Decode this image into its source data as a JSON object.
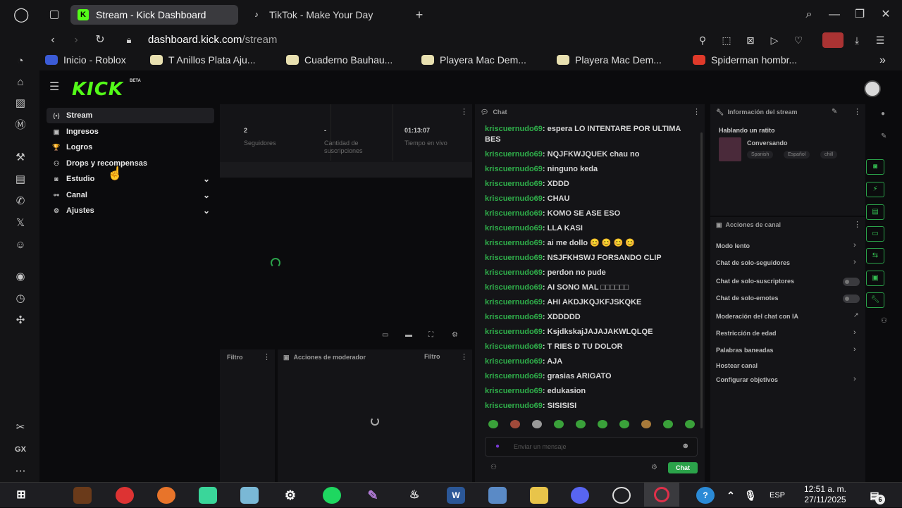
{
  "browser": {
    "tabs": [
      {
        "title": "Stream - Kick Dashboard",
        "active": true
      },
      {
        "title": "TikTok - Make Your Day",
        "active": false
      }
    ],
    "new_tab": "+",
    "url_domain": "dashboard.kick.com",
    "url_path": "/stream",
    "bookmarks": [
      {
        "label": "Inicio - Roblox",
        "color": "#3b5bd6"
      },
      {
        "label": "T Anillos Plata Aju...",
        "color": "#e8e0b0"
      },
      {
        "label": "Cuaderno Bauhau...",
        "color": "#e8e0b0"
      },
      {
        "label": "Playera Mac Dem...",
        "color": "#e8e0b0"
      },
      {
        "label": "Playera Mac Dem...",
        "color": "#e8e0b0"
      },
      {
        "label": "Spiderman hombr...",
        "color": "#e03a2a"
      }
    ]
  },
  "opera_sidebar": {
    "bottom_label": "GX"
  },
  "kick": {
    "logo": "KICK",
    "beta": "BETA",
    "accent": "#53fc18",
    "nav": [
      {
        "label": "Stream",
        "icon": "(•)"
      },
      {
        "label": "Ingresos",
        "icon": "▣"
      },
      {
        "label": "Logros",
        "icon": "🏆"
      },
      {
        "label": "Drops y recompensas",
        "icon": "⚇"
      },
      {
        "label": "Estudio",
        "icon": "◙"
      },
      {
        "label": "Canal",
        "icon": "⚯"
      },
      {
        "label": "Ajustes",
        "icon": "⚙"
      }
    ],
    "stats": [
      {
        "value": "2",
        "label": "Seguidores"
      },
      {
        "value": "-",
        "label": "Cantidad de suscripciones"
      },
      {
        "value": "01:13:07",
        "label": "Tiempo en vivo"
      }
    ],
    "filter_label": "Filtro",
    "mod_actions_title": "Acciones de moderador",
    "mod_filter_label": "Filtro",
    "chat": {
      "title": "Chat",
      "username": "kriscuernudo69",
      "messages": [
        "espera LO INTENTARE POR ULTIMA BES",
        "NQJFKWJQUEK chau no",
        "ninguno keda",
        "XDDD",
        "CHAU",
        "KOMO SE ASE ESO",
        "LLA KASI",
        "ai me dollo 😊 😊 😊 😊",
        "NSJFKHSWJ FORSANDO CLIP",
        "perdon no pude",
        "AI SONO MAL □□□□□□",
        "AHI AKDJKQJKFJSKQKE",
        "XDDDDD",
        "KsjdkskajJAJAJAKWLQLQE",
        "T RIES D TU DOLOR",
        "AJA",
        "grasias ARIGATO",
        "edukasion",
        "SISISISI"
      ],
      "input_placeholder": "Enviar un mensaje",
      "send_label": "Chat"
    },
    "stream_info": {
      "title": "Información del stream",
      "stream_title": "Hablando un ratito",
      "category": "Conversando",
      "tags": [
        "Spanish",
        "Español",
        "chill"
      ]
    },
    "channel_actions": {
      "title": "Acciones de canal",
      "items": [
        {
          "label": "Modo lento",
          "control": "chevron"
        },
        {
          "label": "Chat de solo-seguidores",
          "control": "chevron"
        },
        {
          "label": "Chat de solo-suscriptores",
          "control": "toggle"
        },
        {
          "label": "Chat de solo-emotes",
          "control": "toggle"
        },
        {
          "label": "Moderación del chat con IA",
          "control": "link"
        },
        {
          "label": "Restricción de edad",
          "control": "chevron"
        },
        {
          "label": "Palabras baneadas",
          "control": "chevron"
        },
        {
          "label": "Hostear canal",
          "control": "none"
        },
        {
          "label": "Configurar objetivos",
          "control": "chevron"
        }
      ]
    }
  },
  "taskbar": {
    "language": "ESP",
    "time": "12:51 a. m.",
    "date": "27/11/2025",
    "notifications": "6"
  }
}
